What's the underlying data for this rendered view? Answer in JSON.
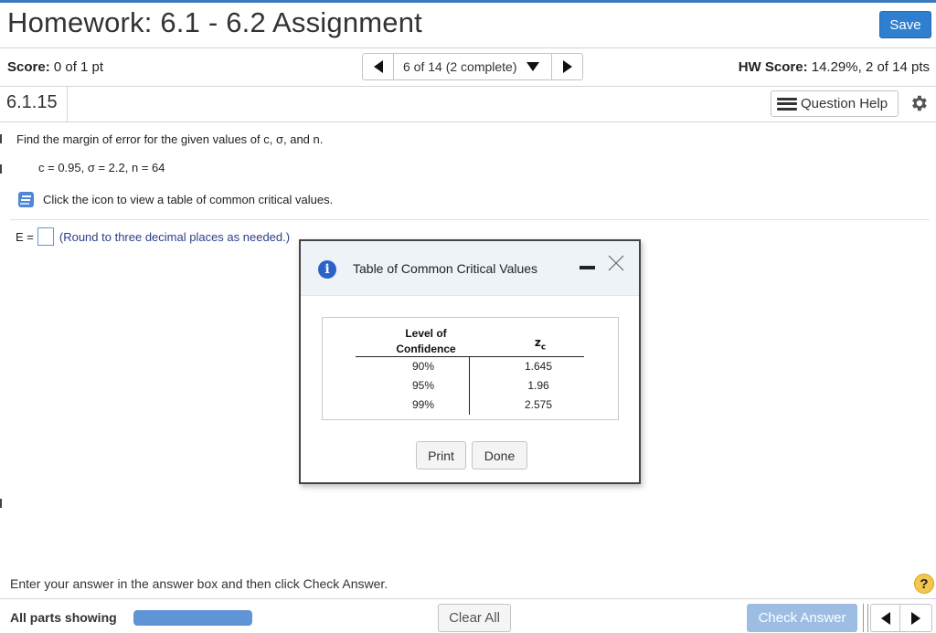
{
  "header": {
    "title": "Homework: 6.1 - 6.2 Assignment",
    "save_label": "Save"
  },
  "score_bar": {
    "score_label": "Score:",
    "score_value": " 0 of 1 pt",
    "nav_position": "6 of 14 (2 complete)",
    "hw_score_label": "HW Score:",
    "hw_score_value": " 14.29%, 2 of 14 pts"
  },
  "question": {
    "number": "6.1.15",
    "help_label": "Question Help",
    "prompt": "Find the margin of error for the given values of c, σ, and n.",
    "values": "c = 0.95, σ = 2.2, n = 64",
    "icon_instruction": "Click the icon to view a table of common critical values.",
    "answer_prefix": "E =",
    "answer_value": "",
    "answer_hint": "(Round to three decimal places as needed.)"
  },
  "modal": {
    "title": "Table of Common Critical Values",
    "table": {
      "col1_header_line1": "Level of",
      "col1_header_line2": "Confidence",
      "col2_header": "z",
      "col2_header_sub": "c",
      "rows": [
        {
          "level": "90%",
          "z": "1.645"
        },
        {
          "level": "95%",
          "z": "1.96"
        },
        {
          "level": "99%",
          "z": "2.575"
        }
      ]
    },
    "print_label": "Print",
    "done_label": "Done"
  },
  "footer": {
    "instruction": "Enter your answer in the answer box and then click Check Answer.",
    "parts_label": "All parts showing",
    "progress_fraction": 1.0,
    "clear_label": "Clear All",
    "check_label": "Check Answer",
    "help_symbol": "?"
  },
  "colors": {
    "accent": "#2f7fd0",
    "progress": "#5f95d7",
    "check_disabled": "#9dbde3",
    "help_yellow": "#f3c74d",
    "hint_text": "#2a3f8a"
  }
}
